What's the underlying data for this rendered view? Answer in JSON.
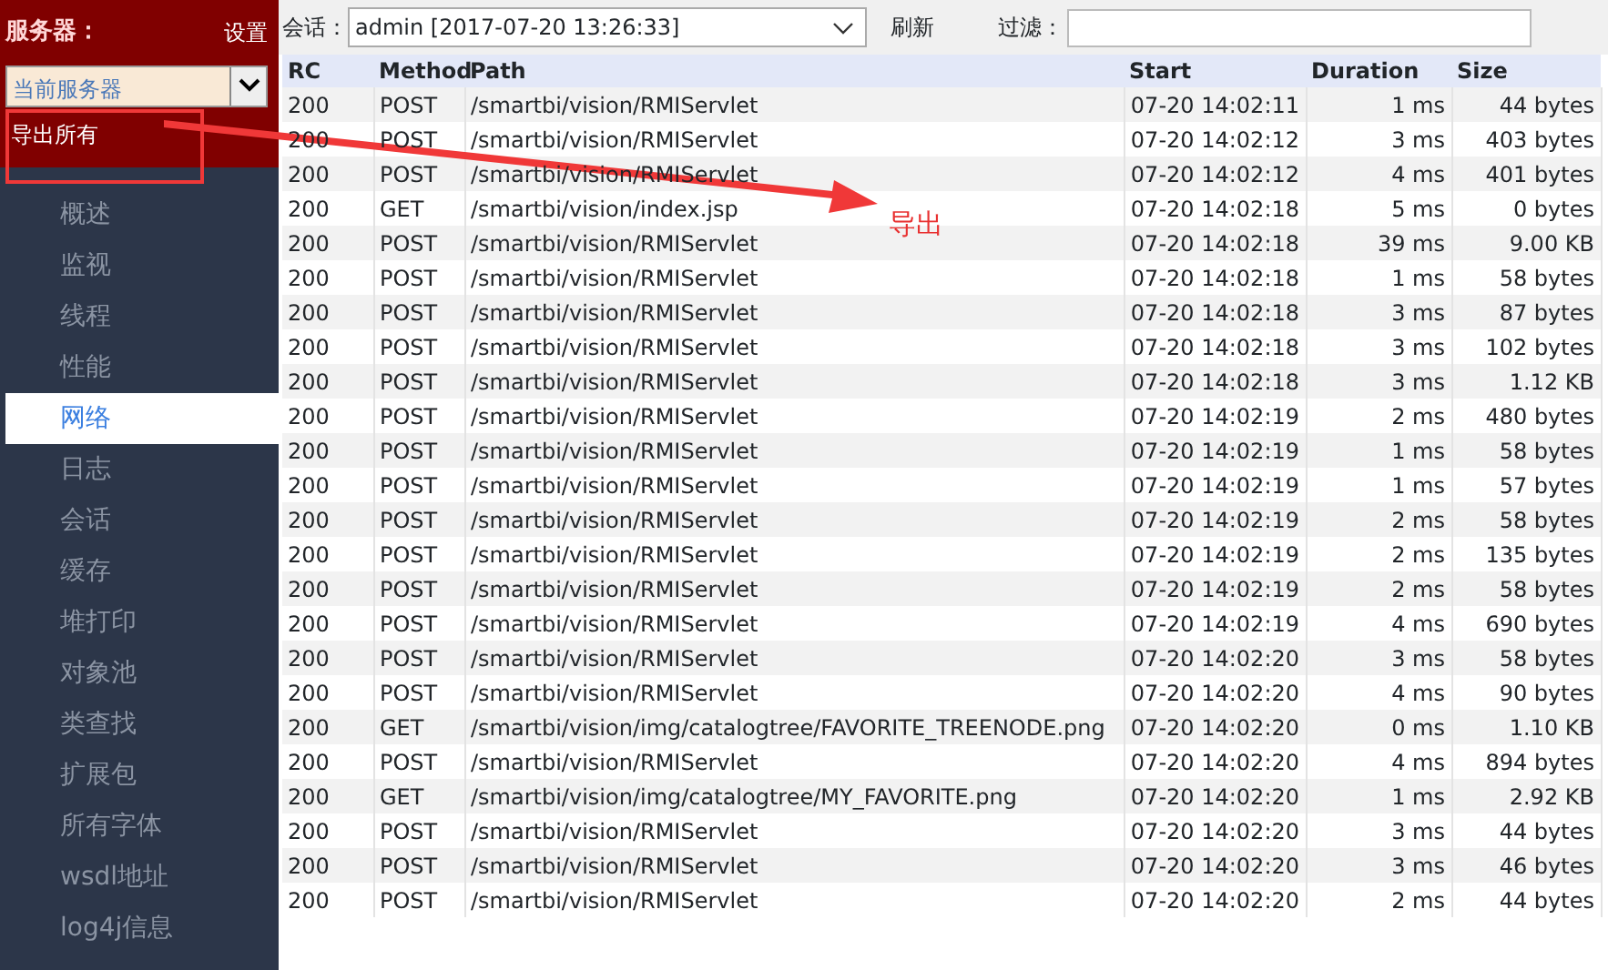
{
  "sidebar": {
    "title": "服务器：",
    "settings": "设置",
    "server_select": "当前服务器",
    "export_all": "导出所有",
    "items": [
      {
        "label": "概述",
        "selected": false
      },
      {
        "label": "监视",
        "selected": false
      },
      {
        "label": "线程",
        "selected": false
      },
      {
        "label": "性能",
        "selected": false
      },
      {
        "label": "网络",
        "selected": true
      },
      {
        "label": "日志",
        "selected": false
      },
      {
        "label": "会话",
        "selected": false
      },
      {
        "label": "缓存",
        "selected": false
      },
      {
        "label": "堆打印",
        "selected": false
      },
      {
        "label": "对象池",
        "selected": false
      },
      {
        "label": "类查找",
        "selected": false
      },
      {
        "label": "扩展包",
        "selected": false
      },
      {
        "label": "所有字体",
        "selected": false
      },
      {
        "label": "wsdl地址",
        "selected": false
      },
      {
        "label": "log4j信息",
        "selected": false
      }
    ]
  },
  "toolbar": {
    "session_label": "会话：",
    "session_value": "admin [2017-07-20 13:26:33]",
    "refresh": "刷新",
    "filter_label": "过滤："
  },
  "table": {
    "columns": [
      "RC",
      "Method",
      "Path",
      "Start",
      "Duration",
      "Size"
    ],
    "rows": [
      [
        "200",
        "POST",
        "/smartbi/vision/RMIServlet",
        "07-20 14:02:11",
        "1 ms",
        "44 bytes"
      ],
      [
        "200",
        "POST",
        "/smartbi/vision/RMIServlet",
        "07-20 14:02:12",
        "3 ms",
        "403 bytes"
      ],
      [
        "200",
        "POST",
        "/smartbi/vision/RMIServlet",
        "07-20 14:02:12",
        "4 ms",
        "401 bytes"
      ],
      [
        "200",
        "GET",
        "/smartbi/vision/index.jsp",
        "07-20 14:02:18",
        "5 ms",
        "0 bytes"
      ],
      [
        "200",
        "POST",
        "/smartbi/vision/RMIServlet",
        "07-20 14:02:18",
        "39 ms",
        "9.00 KB"
      ],
      [
        "200",
        "POST",
        "/smartbi/vision/RMIServlet",
        "07-20 14:02:18",
        "1 ms",
        "58 bytes"
      ],
      [
        "200",
        "POST",
        "/smartbi/vision/RMIServlet",
        "07-20 14:02:18",
        "3 ms",
        "87 bytes"
      ],
      [
        "200",
        "POST",
        "/smartbi/vision/RMIServlet",
        "07-20 14:02:18",
        "3 ms",
        "102 bytes"
      ],
      [
        "200",
        "POST",
        "/smartbi/vision/RMIServlet",
        "07-20 14:02:18",
        "3 ms",
        "1.12 KB"
      ],
      [
        "200",
        "POST",
        "/smartbi/vision/RMIServlet",
        "07-20 14:02:19",
        "2 ms",
        "480 bytes"
      ],
      [
        "200",
        "POST",
        "/smartbi/vision/RMIServlet",
        "07-20 14:02:19",
        "1 ms",
        "58 bytes"
      ],
      [
        "200",
        "POST",
        "/smartbi/vision/RMIServlet",
        "07-20 14:02:19",
        "1 ms",
        "57 bytes"
      ],
      [
        "200",
        "POST",
        "/smartbi/vision/RMIServlet",
        "07-20 14:02:19",
        "2 ms",
        "58 bytes"
      ],
      [
        "200",
        "POST",
        "/smartbi/vision/RMIServlet",
        "07-20 14:02:19",
        "2 ms",
        "135 bytes"
      ],
      [
        "200",
        "POST",
        "/smartbi/vision/RMIServlet",
        "07-20 14:02:19",
        "2 ms",
        "58 bytes"
      ],
      [
        "200",
        "POST",
        "/smartbi/vision/RMIServlet",
        "07-20 14:02:19",
        "4 ms",
        "690 bytes"
      ],
      [
        "200",
        "POST",
        "/smartbi/vision/RMIServlet",
        "07-20 14:02:20",
        "3 ms",
        "58 bytes"
      ],
      [
        "200",
        "POST",
        "/smartbi/vision/RMIServlet",
        "07-20 14:02:20",
        "4 ms",
        "90 bytes"
      ],
      [
        "200",
        "GET",
        "/smartbi/vision/img/catalogtree/FAVORITE_TREENODE.png",
        "07-20 14:02:20",
        "0 ms",
        "1.10 KB"
      ],
      [
        "200",
        "POST",
        "/smartbi/vision/RMIServlet",
        "07-20 14:02:20",
        "4 ms",
        "894 bytes"
      ],
      [
        "200",
        "GET",
        "/smartbi/vision/img/catalogtree/MY_FAVORITE.png",
        "07-20 14:02:20",
        "1 ms",
        "2.92 KB"
      ],
      [
        "200",
        "POST",
        "/smartbi/vision/RMIServlet",
        "07-20 14:02:20",
        "3 ms",
        "44 bytes"
      ],
      [
        "200",
        "POST",
        "/smartbi/vision/RMIServlet",
        "07-20 14:02:20",
        "3 ms",
        "46 bytes"
      ],
      [
        "200",
        "POST",
        "/smartbi/vision/RMIServlet",
        "07-20 14:02:20",
        "2 ms",
        "44 bytes"
      ]
    ]
  },
  "annotation": {
    "label": "导出"
  }
}
